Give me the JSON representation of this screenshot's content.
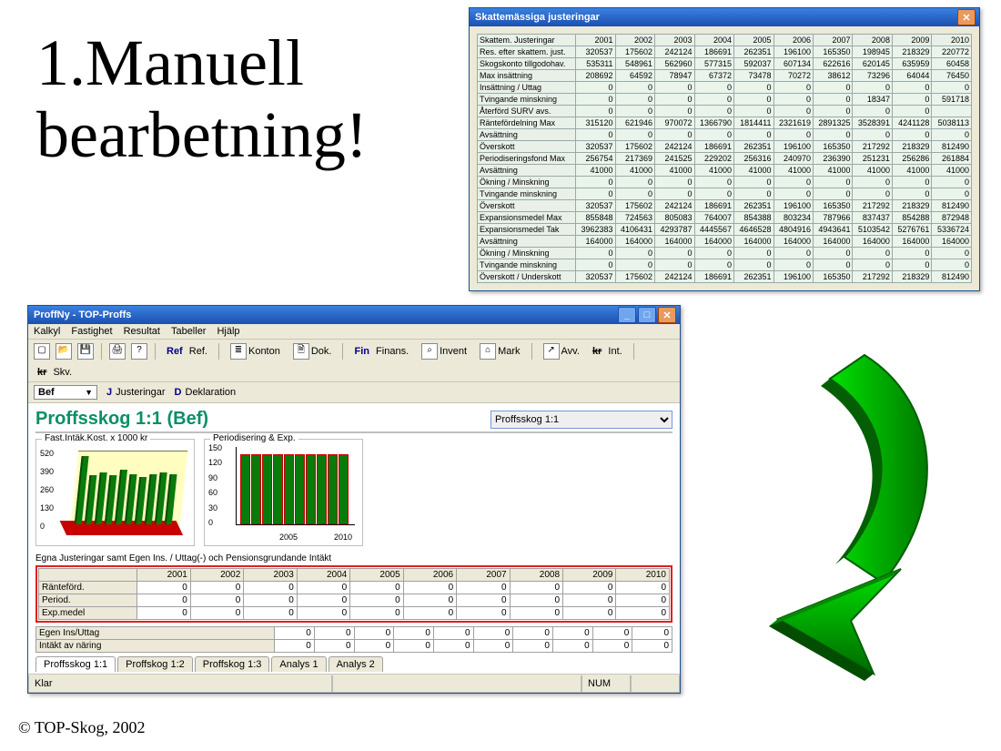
{
  "slide": {
    "heading_line1": "1.Manuell",
    "heading_line2": "bearbetning!",
    "copyright": "© TOP-Skog, 2002"
  },
  "win2": {
    "title": "Skattemässiga justeringar",
    "years": [
      "2001",
      "2002",
      "2003",
      "2004",
      "2005",
      "2006",
      "2007",
      "2008",
      "2009",
      "2010"
    ],
    "rows": [
      {
        "label": "Skattem. Justeringar",
        "cells": [
          "",
          "",
          "",
          "",
          "",
          "",
          "",
          "",
          "",
          ""
        ]
      },
      {
        "label": "Res. efter skattem. just.",
        "cells": [
          "320537",
          "175602",
          "242124",
          "186691",
          "262351",
          "196100",
          "165350",
          "198945",
          "218329",
          "220772"
        ]
      },
      {
        "label": "Skogskonto tillgodohav.",
        "cells": [
          "535311",
          "548961",
          "562960",
          "577315",
          "592037",
          "607134",
          "622616",
          "620145",
          "635959",
          "60458"
        ]
      },
      {
        "label": "Max insättning",
        "cells": [
          "208692",
          "64592",
          "78947",
          "67372",
          "73478",
          "70272",
          "38612",
          "73296",
          "64044",
          "76450"
        ]
      },
      {
        "label": "Insättning / Uttag",
        "cells": [
          "0",
          "0",
          "0",
          "0",
          "0",
          "0",
          "0",
          "0",
          "0",
          "0"
        ]
      },
      {
        "label": "Tvingande minskning",
        "cells": [
          "0",
          "0",
          "0",
          "0",
          "0",
          "0",
          "0",
          "18347",
          "0",
          "591718"
        ]
      },
      {
        "label": "Återförd SURV avs.",
        "cells": [
          "0",
          "0",
          "0",
          "0",
          "0",
          "0",
          "0",
          "0",
          "0",
          ""
        ]
      },
      {
        "label": "Räntefördelning Max",
        "cells": [
          "315120",
          "621946",
          "970072",
          "1366790",
          "1814411",
          "2321619",
          "2891325",
          "3528391",
          "4241128",
          "5038113"
        ]
      },
      {
        "label": "Avsättning",
        "cells": [
          "0",
          "0",
          "0",
          "0",
          "0",
          "0",
          "0",
          "0",
          "0",
          "0"
        ]
      },
      {
        "label": "Överskott",
        "cells": [
          "320537",
          "175602",
          "242124",
          "186691",
          "262351",
          "196100",
          "165350",
          "217292",
          "218329",
          "812490"
        ]
      },
      {
        "label": "Periodiseringsfond Max",
        "cells": [
          "256754",
          "217369",
          "241525",
          "229202",
          "256316",
          "240970",
          "236390",
          "251231",
          "256286",
          "261884"
        ]
      },
      {
        "label": "Avsättning",
        "cells": [
          "41000",
          "41000",
          "41000",
          "41000",
          "41000",
          "41000",
          "41000",
          "41000",
          "41000",
          "41000"
        ]
      },
      {
        "label": "Ökning / Minskning",
        "cells": [
          "0",
          "0",
          "0",
          "0",
          "0",
          "0",
          "0",
          "0",
          "0",
          "0"
        ]
      },
      {
        "label": "Tvingande minskning",
        "cells": [
          "0",
          "0",
          "0",
          "0",
          "0",
          "0",
          "0",
          "0",
          "0",
          "0"
        ]
      },
      {
        "label": "Överskott",
        "cells": [
          "320537",
          "175602",
          "242124",
          "186691",
          "262351",
          "196100",
          "165350",
          "217292",
          "218329",
          "812490"
        ]
      },
      {
        "label": "Expansionsmedel Max",
        "cells": [
          "855848",
          "724563",
          "805083",
          "764007",
          "854388",
          "803234",
          "787966",
          "837437",
          "854288",
          "872948"
        ]
      },
      {
        "label": "Expansionsmedel Tak",
        "cells": [
          "3962383",
          "4106431",
          "4293787",
          "4445567",
          "4646528",
          "4804916",
          "4943641",
          "5103542",
          "5276761",
          "5336724"
        ]
      },
      {
        "label": "Avsättning",
        "cells": [
          "164000",
          "164000",
          "164000",
          "164000",
          "164000",
          "164000",
          "164000",
          "164000",
          "164000",
          "164000"
        ]
      },
      {
        "label": "Ökning / Minskning",
        "cells": [
          "0",
          "0",
          "0",
          "0",
          "0",
          "0",
          "0",
          "0",
          "0",
          "0"
        ]
      },
      {
        "label": "Tvingande minskning",
        "cells": [
          "0",
          "0",
          "0",
          "0",
          "0",
          "0",
          "0",
          "0",
          "0",
          "0"
        ]
      },
      {
        "label": "Överskott / Underskott",
        "cells": [
          "320537",
          "175602",
          "242124",
          "186691",
          "262351",
          "196100",
          "165350",
          "217292",
          "218329",
          "812490"
        ]
      }
    ]
  },
  "win1": {
    "title": "ProffNy - TOP-Proffs",
    "menus": [
      "Kalkyl",
      "Fastighet",
      "Resultat",
      "Tabeller",
      "Hjälp"
    ],
    "toolbar": {
      "ref": "Ref",
      "ref2": "Ref.",
      "konton": "Konton",
      "dok": "Dok.",
      "fin": "Fin",
      "finans": "Finans.",
      "invent": "Invent",
      "mark": "Mark",
      "avv": "Avv.",
      "int": "Int.",
      "skv": "Skv."
    },
    "row2": {
      "combo": "Bef",
      "chev": "▼",
      "j": "J",
      "just": "Justeringar",
      "d": "D",
      "dekl": "Deklaration"
    },
    "doc_title": "Proffsskog 1:1 (Bef)",
    "selector": "Proffsskog 1:1",
    "chart1_title": "Fast.Intäk.Kost. x 1000 kr",
    "chart2_title": "Periodisering & Exp.",
    "chart2_x1": "2005",
    "chart2_x2": "2010",
    "section": "Egna Justeringar samt Egen Ins. / Uttag(-) och Pensionsgrundande Intäkt",
    "years": [
      "2001",
      "2002",
      "2003",
      "2004",
      "2005",
      "2006",
      "2007",
      "2008",
      "2009",
      "2010"
    ],
    "grid_rows": [
      {
        "label": "Ränteförd.",
        "cells": [
          "0",
          "0",
          "0",
          "0",
          "0",
          "0",
          "0",
          "0",
          "0",
          "0"
        ]
      },
      {
        "label": "Period.",
        "cells": [
          "0",
          "0",
          "0",
          "0",
          "0",
          "0",
          "0",
          "0",
          "0",
          "0"
        ]
      },
      {
        "label": "Exp.medel",
        "cells": [
          "0",
          "0",
          "0",
          "0",
          "0",
          "0",
          "0",
          "0",
          "0",
          "0"
        ]
      }
    ],
    "grid2_rows": [
      {
        "label": "Egen Ins/Uttag",
        "cells": [
          "0",
          "0",
          "0",
          "0",
          "0",
          "0",
          "0",
          "0",
          "0",
          "0"
        ]
      },
      {
        "label": "Intäkt av näring",
        "cells": [
          "0",
          "0",
          "0",
          "0",
          "0",
          "0",
          "0",
          "0",
          "0",
          "0"
        ]
      }
    ],
    "tabs": [
      "Proffsskog 1:1",
      "Proffskog 1:2",
      "Proffskog 1:3",
      "Analys 1",
      "Analys 2"
    ],
    "status_left": "Klar",
    "status_num": "NUM"
  },
  "chart_data": [
    {
      "type": "bar",
      "title": "Fast.Intäk.Kost. x 1000 kr",
      "yticks": [
        0,
        130,
        260,
        390,
        520
      ],
      "categories": [
        "2001",
        "2002",
        "2003",
        "2004",
        "2005",
        "2006",
        "2007",
        "2008",
        "2009",
        "2010"
      ],
      "values": [
        500,
        360,
        380,
        360,
        400,
        370,
        350,
        370,
        380,
        370
      ],
      "ylim": [
        0,
        520
      ]
    },
    {
      "type": "bar",
      "title": "Periodisering & Exp.",
      "yticks": [
        0,
        30,
        60,
        90,
        120,
        150
      ],
      "categories": [
        "2001",
        "2002",
        "2003",
        "2004",
        "2005",
        "2006",
        "2007",
        "2008",
        "2009",
        "2010"
      ],
      "values": [
        140,
        140,
        140,
        140,
        140,
        140,
        140,
        140,
        140,
        140
      ],
      "xlabel_positions": [
        "2005",
        "2010"
      ],
      "ylim": [
        0,
        150
      ]
    }
  ]
}
